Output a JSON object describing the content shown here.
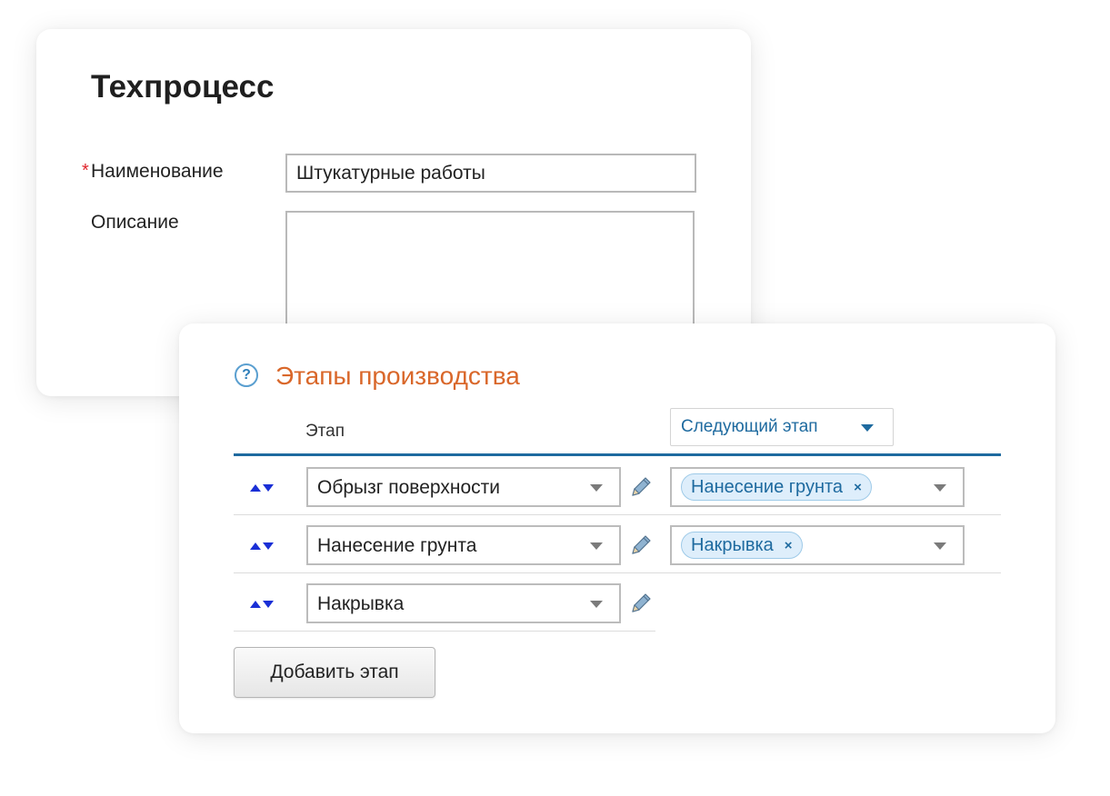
{
  "process_card": {
    "title": "Техпроцесс",
    "name_required_mark": "*",
    "name_label": "Наименование",
    "name_value": "Штукатурные работы",
    "description_label": "Описание",
    "description_value": ""
  },
  "stages_card": {
    "help_glyph": "?",
    "title": "Этапы производства",
    "stage_column_label": "Этап",
    "next_stage_button_label": "Следующий этап",
    "rows": [
      {
        "stage": "Обрызг поверхности",
        "next_stage_tag": "Нанесение грунта",
        "remove_glyph": "×"
      },
      {
        "stage": "Нанесение грунта",
        "next_stage_tag": "Накрывка",
        "remove_glyph": "×"
      },
      {
        "stage": "Накрывка"
      }
    ],
    "add_stage_button_label": "Добавить этап"
  },
  "colors": {
    "section_title": "#d9672a",
    "accent_blue": "#1e6a9f",
    "tag_background": "#deeefb",
    "required_mark": "#e0242b",
    "sort_arrows": "#1a2fd6"
  },
  "icons": [
    "help-icon",
    "sort-arrows-icon",
    "pencil-icon",
    "chevron-down-icon",
    "remove-tag-icon"
  ]
}
